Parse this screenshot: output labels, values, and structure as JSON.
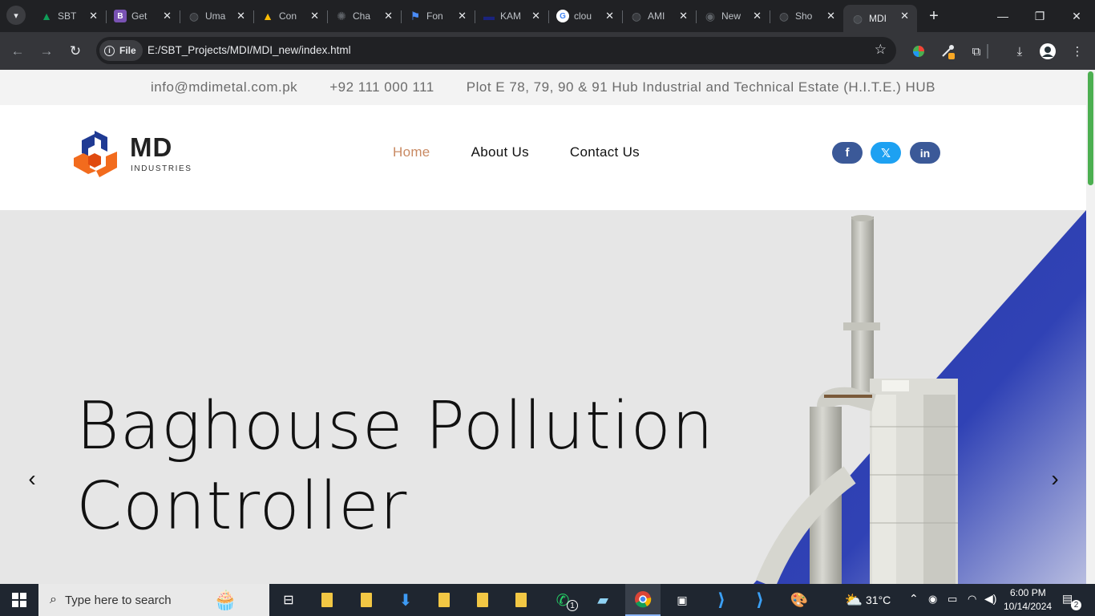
{
  "browser": {
    "tabs": [
      {
        "title": "SBT",
        "icon": "google-drive-icon",
        "color": "#0f9d58"
      },
      {
        "title": "Get",
        "icon": "bootstrap-icon",
        "color": "#7952b3"
      },
      {
        "title": "Uma",
        "icon": "globe-icon",
        "color": "#5f6368"
      },
      {
        "title": "Con",
        "icon": "google-ads-icon",
        "color": "#fbbc04"
      },
      {
        "title": "Cha",
        "icon": "chatgpt-icon",
        "color": "#5f6368"
      },
      {
        "title": "Fon",
        "icon": "flag-icon",
        "color": "#4a8cf7"
      },
      {
        "title": "KAM",
        "icon": "kam-icon",
        "color": "#1a237e"
      },
      {
        "title": "clou",
        "icon": "google-icon",
        "color": "#ffffff"
      },
      {
        "title": "AMI",
        "icon": "globe-icon",
        "color": "#5f6368"
      },
      {
        "title": "New",
        "icon": "chrome-icon",
        "color": "#5f6368"
      },
      {
        "title": "Sho",
        "icon": "globe-icon",
        "color": "#5f6368"
      },
      {
        "title": "MDI",
        "icon": "globe-icon",
        "color": "#5f6368",
        "active": true
      }
    ],
    "file_chip": "File",
    "url": "E:/SBT_Projects/MDI/MDI_new/index.html"
  },
  "topbar": {
    "email": "info@mdimetal.com.pk",
    "phone": "+92 111 000 111",
    "address": "Plot E 78, 79, 90 & 91 Hub Industrial and Technical Estate (H.I.T.E.) HUB"
  },
  "header": {
    "logo_main": "MD",
    "logo_sub": "INDUSTRIES",
    "nav": [
      "Home",
      "About Us",
      "Contact Us"
    ],
    "social": {
      "facebook": "f",
      "twitter": "𝕏",
      "linkedin": "in",
      "colors": {
        "facebook": "#3b5998",
        "twitter": "#1da1f2",
        "linkedin": "#3b5998"
      }
    },
    "accent_color": "#c98a63"
  },
  "hero": {
    "title_line1": "Baghouse Pollution",
    "title_line2": "Controller",
    "prev": "‹",
    "next": "›",
    "accent_color": "#2a3aa8"
  },
  "taskbar": {
    "search_placeholder": "Type here to search",
    "weather": "31°C",
    "time": "6:00 PM",
    "date": "10/14/2024",
    "notifications": "2",
    "whatsapp_badge": "1"
  }
}
